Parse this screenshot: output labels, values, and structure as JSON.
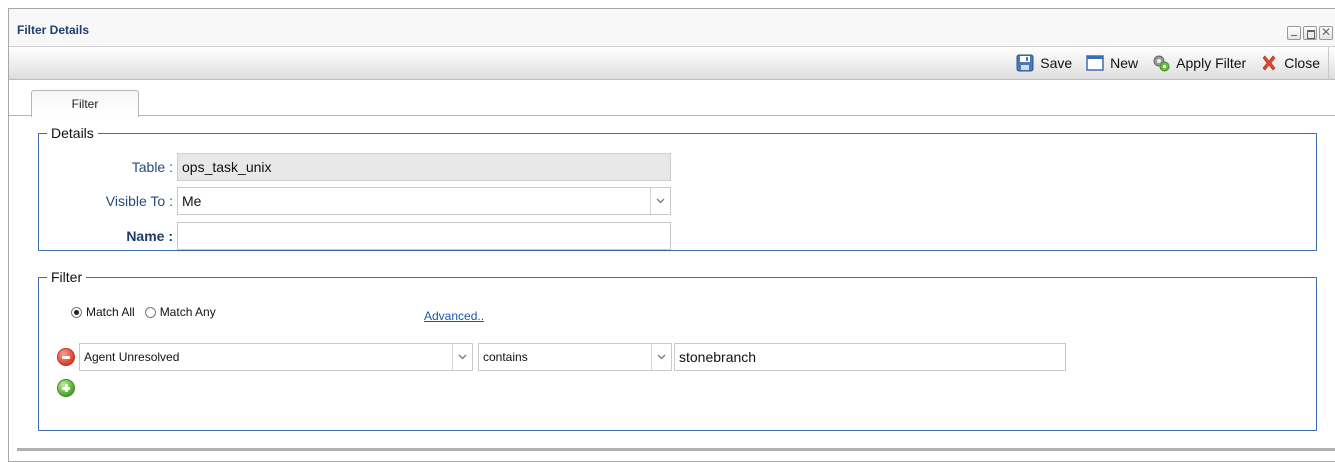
{
  "window": {
    "title": "Filter Details",
    "controls": {
      "minimize": "–",
      "maximize": "□",
      "close": "✕"
    }
  },
  "toolbar": {
    "buttons": [
      {
        "label": "Save",
        "icon": "floppy-disk-icon"
      },
      {
        "label": "New",
        "icon": "new-window-icon"
      },
      {
        "label": "Apply Filter",
        "icon": "apply-filter-icon"
      },
      {
        "label": "Close",
        "icon": "close-x-icon"
      }
    ]
  },
  "tabs": [
    {
      "label": "Filter",
      "active": true
    }
  ],
  "details": {
    "legend": "Details",
    "table_label": "Table :",
    "table_value": "ops_task_unix",
    "visible_to_label": "Visible To :",
    "visible_to_value": "Me",
    "name_label": "Name :",
    "name_value": ""
  },
  "filter": {
    "legend": "Filter",
    "match_all_label": "Match All",
    "match_any_label": "Match Any",
    "match_selected": "all",
    "advanced_link": "Advanced..",
    "conditions": [
      {
        "field": "Agent Unresolved",
        "operator": "contains",
        "value": "stonebranch"
      }
    ]
  },
  "colors": {
    "title_text": "#1f3f6e",
    "fieldset_border": "#3b6bb0",
    "link": "#1a55b5",
    "remove_button": "#d8402e",
    "add_button": "#4aa52a"
  }
}
